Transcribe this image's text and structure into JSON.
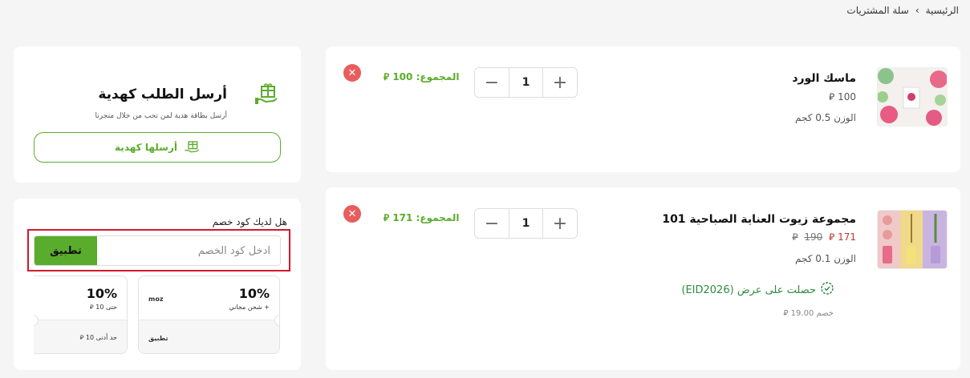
{
  "breadcrumb": {
    "home": "الرئيسية",
    "separator": "›",
    "current": "سلة المشتريات"
  },
  "currency_symbol": "⃁",
  "cart_items": [
    {
      "name": "ماسك الورد",
      "price": "100",
      "weight": "الوزن 0.5 كجم",
      "quantity": "1",
      "total_label": "المجموع:",
      "total_value": "100"
    },
    {
      "name": "مجموعة زيوت العناية الصباحية 101",
      "price_new": "171",
      "price_old": "190",
      "weight": "الوزن 0.1 كجم",
      "quantity": "1",
      "total_label": "المجموع:",
      "total_value": "171",
      "offer_text": "حصلت على عرض (EID2026)",
      "discount_text": "خصم 19.00"
    }
  ],
  "gift": {
    "title": "أرسل الطلب كهدية",
    "subtitle": "أرسل بطاقة هدية لمن تحب من خلال متجرنا",
    "button_label": "أرسلها كهدية"
  },
  "coupon": {
    "question": "هل لديك كود خصم",
    "placeholder": "ادخل كود الخصم",
    "apply_label": "تطبيق"
  },
  "coupons": [
    {
      "percent": "10%",
      "description": "+ شحن مجاني",
      "code": "moz",
      "apply_label": "تطبيق"
    },
    {
      "percent": "10%",
      "description": "حتى 10",
      "footer": "حد أدنى 10"
    }
  ],
  "colors": {
    "accent": "#5aac2c",
    "danger": "#e85d5d",
    "highlight": "#d11a2a"
  }
}
